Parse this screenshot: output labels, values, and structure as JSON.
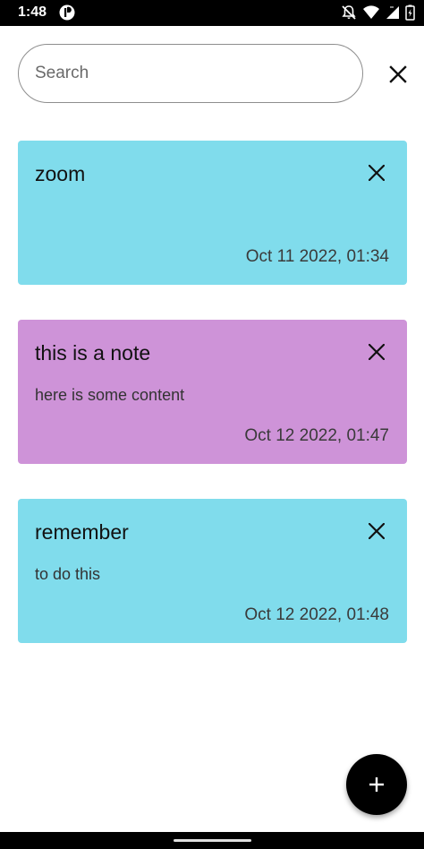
{
  "status_bar": {
    "time": "1:48",
    "icons": [
      "app-notification-icon",
      "mute-icon",
      "wifi-icon",
      "signal-icon",
      "battery-icon"
    ]
  },
  "search": {
    "placeholder": "Search",
    "value": "",
    "clear_icon": "close-icon"
  },
  "notes": [
    {
      "title": "zoom",
      "content": "",
      "date": "Oct 11 2022, 01:34",
      "color": "#80dcec",
      "delete_icon": "close-icon"
    },
    {
      "title": "this is a note",
      "content": "here is some content",
      "date": "Oct 12 2022, 01:47",
      "color": "#ce93d8",
      "delete_icon": "close-icon"
    },
    {
      "title": "remember",
      "content": "to do this",
      "date": "Oct 12 2022, 01:48",
      "color": "#80dcec",
      "delete_icon": "close-icon"
    }
  ],
  "fab": {
    "icon": "plus-icon",
    "color": "#000000"
  },
  "colors": {
    "status_bar": "#000000",
    "background": "#ffffff",
    "note_cyan": "#80dcec",
    "note_purple": "#ce93d8"
  }
}
